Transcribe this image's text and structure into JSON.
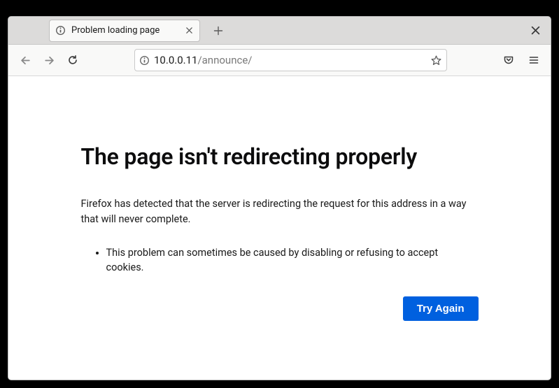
{
  "tab": {
    "title": "Problem loading page"
  },
  "url": {
    "host": "10.0.0.11",
    "path": "/announce/"
  },
  "error": {
    "heading": "The page isn't redirecting properly",
    "description": "Firefox has detected that the server is redirecting the request for this address in a way that will never complete.",
    "hint": "This problem can sometimes be caused by disabling or refusing to accept cookies.",
    "button": "Try Again"
  }
}
